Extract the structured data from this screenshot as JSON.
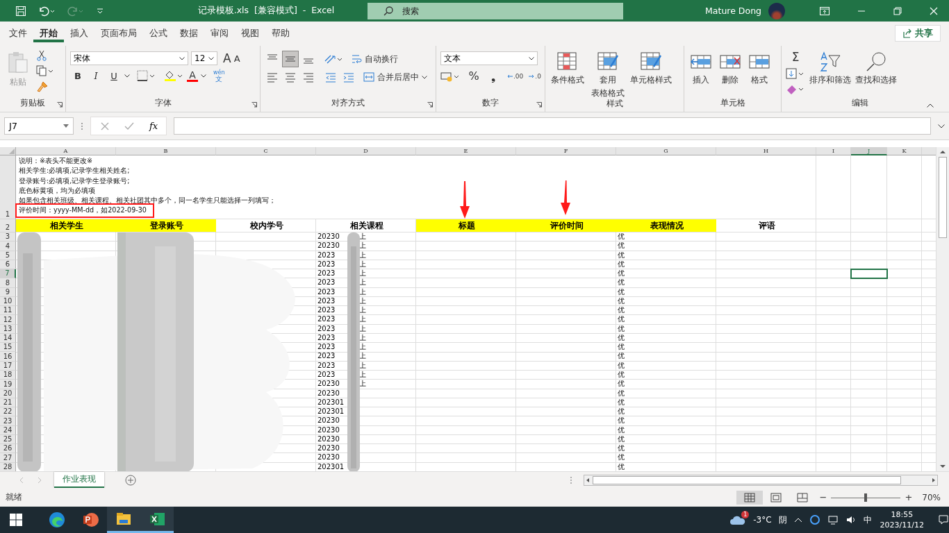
{
  "title_bar": {
    "title": "记录模板.xls  [兼容模式]  -  Excel",
    "search_placeholder": "搜索",
    "user": "Mature Dong"
  },
  "menu_tabs": [
    {
      "label": "文件",
      "selected": false
    },
    {
      "label": "开始",
      "selected": true
    },
    {
      "label": "插入",
      "selected": false
    },
    {
      "label": "页面布局",
      "selected": false
    },
    {
      "label": "公式",
      "selected": false
    },
    {
      "label": "数据",
      "selected": false
    },
    {
      "label": "审阅",
      "selected": false
    },
    {
      "label": "视图",
      "selected": false
    },
    {
      "label": "帮助",
      "selected": false
    }
  ],
  "share": "共享",
  "ribbon": {
    "clipboard": {
      "label": "剪贴板",
      "paste": "粘贴"
    },
    "font": {
      "label": "字体",
      "font_name": "宋体",
      "font_size": "12",
      "grow": "A",
      "shrink": "A",
      "format_buttons": [
        "B",
        "I",
        "U"
      ],
      "font_color": "A",
      "pinyin": "wén",
      "pinyin_char": "文"
    },
    "alignment": {
      "label": "对齐方式",
      "wrap_text": "自动换行",
      "merge_center": "合并后居中",
      "middle_selected": true
    },
    "number": {
      "label": "数字",
      "format": "文本",
      "percent": "%",
      "comma": "❟",
      "dec_more": ".00",
      "dec_less": ".0"
    },
    "styles": {
      "label": "样式",
      "buttons": [
        {
          "label": "条件格式"
        },
        {
          "label": "套用",
          "label2": "表格格式"
        },
        {
          "label": "单元格样式"
        }
      ]
    },
    "cells": {
      "label": "单元格",
      "buttons": [
        "插入",
        "删除",
        "格式"
      ]
    },
    "editing": {
      "label": "编辑",
      "sum": "Σ",
      "buttons": [
        "排序和筛选",
        "查找和选择"
      ]
    }
  },
  "formula_bar": {
    "name_box": "J7",
    "fx": "fx"
  },
  "columns": [
    {
      "label": "A",
      "selected": false
    },
    {
      "label": "B",
      "selected": false
    },
    {
      "label": "C",
      "selected": false
    },
    {
      "label": "D",
      "selected": false
    },
    {
      "label": "E",
      "selected": false
    },
    {
      "label": "F",
      "selected": false
    },
    {
      "label": "G",
      "selected": false
    },
    {
      "label": "H",
      "selected": false
    },
    {
      "label": "I",
      "selected": false
    },
    {
      "label": "J",
      "selected": true
    },
    {
      "label": "K",
      "selected": false
    }
  ],
  "note": {
    "row": "1",
    "lines": [
      {
        "text": "说明：※表头不能更改※",
        "boxed": false
      },
      {
        "text": "相关学生:必填项,记录学生相关姓名;",
        "boxed": false
      },
      {
        "text": "登录账号:必填项,记录学生登录账号;",
        "boxed": false
      },
      {
        "text": "底色标黄项，均为必填项",
        "boxed": false
      },
      {
        "text": "如果包含相关班级、相关课程、相关社团其中多个，同一名学生只能选择一列填写；",
        "boxed": false
      },
      {
        "text": "评价时间：yyyy-MM-dd，如2022-09-30",
        "boxed": true
      }
    ]
  },
  "header_row": {
    "row": "2",
    "cells": [
      {
        "text": "相关学生",
        "required": true
      },
      {
        "text": "登录账号",
        "required": true
      },
      {
        "text": "校内学号",
        "required": false
      },
      {
        "text": "相关课程",
        "required": false
      },
      {
        "text": "标题",
        "required": true
      },
      {
        "text": "评价时间",
        "required": true
      },
      {
        "text": "表现情况",
        "required": true
      },
      {
        "text": "评语",
        "required": false
      }
    ]
  },
  "rows": [
    {
      "row": "3",
      "course": "20230",
      "course_tail": "上",
      "rating": "优",
      "selected": false
    },
    {
      "row": "4",
      "course": "20230",
      "course_tail": "上",
      "rating": "优",
      "selected": false
    },
    {
      "row": "5",
      "course": "2023",
      "course_tail": "上",
      "rating": "优",
      "selected": false
    },
    {
      "row": "6",
      "course": "2023",
      "course_tail": "上",
      "rating": "优",
      "selected": false
    },
    {
      "row": "7",
      "course": "2023",
      "course_tail": "上",
      "rating": "优",
      "selected": true
    },
    {
      "row": "8",
      "course": "2023",
      "course_tail": "上",
      "rating": "优",
      "selected": false
    },
    {
      "row": "9",
      "course": "2023",
      "course_tail": "上",
      "rating": "优",
      "selected": false
    },
    {
      "row": "10",
      "course": "2023",
      "course_tail": "上",
      "rating": "优",
      "selected": false
    },
    {
      "row": "11",
      "course": "2023",
      "course_tail": "上",
      "rating": "优",
      "selected": false
    },
    {
      "row": "12",
      "course": "2023",
      "course_tail": "上",
      "rating": "优",
      "selected": false
    },
    {
      "row": "13",
      "course": "2023",
      "course_tail": "上",
      "rating": "优",
      "selected": false
    },
    {
      "row": "14",
      "course": "2023",
      "course_tail": "上",
      "rating": "优",
      "selected": false
    },
    {
      "row": "15",
      "course": "2023",
      "course_tail": "上",
      "rating": "优",
      "selected": false
    },
    {
      "row": "16",
      "course": "2023",
      "course_tail": "上",
      "rating": "优",
      "selected": false
    },
    {
      "row": "17",
      "course": "2023",
      "course_tail": "上",
      "rating": "优",
      "selected": false
    },
    {
      "row": "18",
      "course": "2023",
      "course_tail": "上",
      "rating": "优",
      "selected": false
    },
    {
      "row": "19",
      "course": "20230",
      "course_tail": "上",
      "rating": "优",
      "selected": false
    },
    {
      "row": "20",
      "course": "20230",
      "rating": "优",
      "selected": false
    },
    {
      "row": "21",
      "course": "202301",
      "rating": "优",
      "selected": false
    },
    {
      "row": "22",
      "course": "202301",
      "rating": "优",
      "selected": false
    },
    {
      "row": "23",
      "course": "20230",
      "rating": "优",
      "selected": false
    },
    {
      "row": "24",
      "course": "20230",
      "rating": "优",
      "selected": false
    },
    {
      "row": "25",
      "course": "20230",
      "rating": "优",
      "selected": false
    },
    {
      "row": "26",
      "course": "20230",
      "rating": "优",
      "selected": false
    },
    {
      "row": "27",
      "course": "20230",
      "rating": "优",
      "selected": false
    },
    {
      "row": "28",
      "course": "202301",
      "rating": "优",
      "selected": false
    }
  ],
  "sheet_tabs": [
    {
      "label": "作业表现",
      "selected": true
    }
  ],
  "status_bar": {
    "status": "就绪",
    "views": [
      {
        "kind": "normal",
        "selected": true
      },
      {
        "kind": "layout",
        "selected": false
      },
      {
        "kind": "pagebreak",
        "selected": false
      }
    ],
    "minus": "−",
    "plus": "+",
    "zoom": {
      "level": 0.5
    },
    "zoom_text": "70%"
  },
  "taskbar": {
    "apps": [
      {
        "kind": "edge",
        "selected": false
      },
      {
        "kind": "powerpoint",
        "selected": false
      },
      {
        "kind": "explorer",
        "selected": true
      },
      {
        "kind": "excel",
        "selected": true
      }
    ],
    "weather_badge": "1",
    "temperature": "-3°C",
    "weather": "阴",
    "ime": "中",
    "time": "18:55",
    "date": "2023/11/12"
  }
}
